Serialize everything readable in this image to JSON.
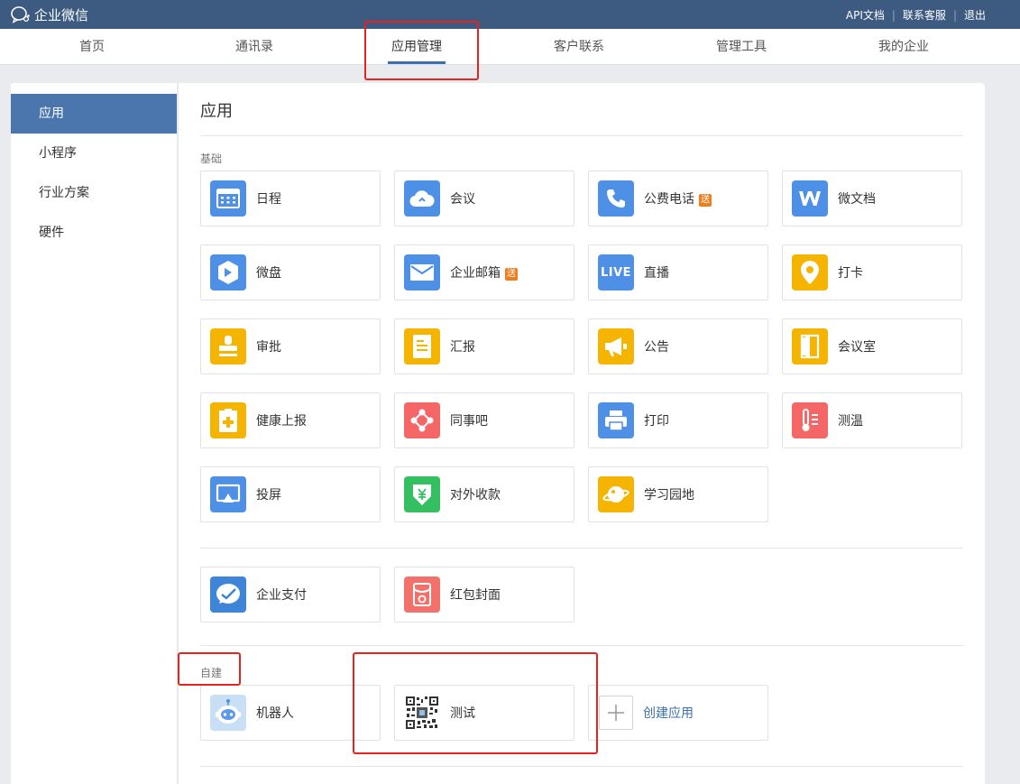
{
  "topbar": {
    "brand": "企业微信",
    "links": [
      "API文档",
      "联系客服",
      "退出"
    ]
  },
  "nav": {
    "tabs": [
      "首页",
      "通讯录",
      "应用管理",
      "客户联系",
      "管理工具",
      "我的企业"
    ],
    "active": "应用管理"
  },
  "sidebar": {
    "items": [
      "应用",
      "小程序",
      "行业方案",
      "硬件"
    ],
    "active": "应用"
  },
  "main": {
    "title": "应用",
    "basic_label": "基础",
    "basic_apps": [
      {
        "name": "日程",
        "icon": "calendar-icon",
        "color": "#4d90e5"
      },
      {
        "name": "会议",
        "icon": "cloud-meeting-icon",
        "color": "#4d90e5"
      },
      {
        "name": "公费电话",
        "icon": "phone-icon",
        "color": "#4d90e5",
        "badge": "送"
      },
      {
        "name": "微文档",
        "icon": "doc-w-icon",
        "color": "#4d90e5"
      },
      {
        "name": "微盘",
        "icon": "drive-icon",
        "color": "#4d90e5"
      },
      {
        "name": "企业邮箱",
        "icon": "mail-icon",
        "color": "#4d90e5",
        "badge": "送"
      },
      {
        "name": "直播",
        "icon": "live-icon",
        "color": "#4d90e5",
        "icon_text": "LIVE"
      },
      {
        "name": "打卡",
        "icon": "location-pin-icon",
        "color": "#f5b400"
      },
      {
        "name": "审批",
        "icon": "stamp-icon",
        "color": "#f5b400"
      },
      {
        "name": "汇报",
        "icon": "report-icon",
        "color": "#f5b400"
      },
      {
        "name": "公告",
        "icon": "megaphone-icon",
        "color": "#f5b400"
      },
      {
        "name": "会议室",
        "icon": "door-icon",
        "color": "#f5b400"
      },
      {
        "name": "健康上报",
        "icon": "health-clipboard-icon",
        "color": "#f5b400"
      },
      {
        "name": "同事吧",
        "icon": "colleague-network-icon",
        "color": "#f56767"
      },
      {
        "name": "打印",
        "icon": "printer-icon",
        "color": "#4d90e5"
      },
      {
        "name": "测温",
        "icon": "thermometer-icon",
        "color": "#f56767"
      },
      {
        "name": "投屏",
        "icon": "screen-cast-icon",
        "color": "#4d90e5"
      },
      {
        "name": "对外收款",
        "icon": "yuan-shield-icon",
        "color": "#34c060"
      },
      {
        "name": "学习园地",
        "icon": "planet-icon",
        "color": "#f5b400"
      }
    ],
    "pay_apps": [
      {
        "name": "企业支付",
        "icon": "enterprise-pay-icon",
        "color": "#3c85d8"
      },
      {
        "name": "红包封面",
        "icon": "red-envelope-icon",
        "color": "#f2716b"
      }
    ],
    "custom_label": "自建",
    "custom_apps": [
      {
        "name": "机器人",
        "icon": "robot-icon"
      },
      {
        "name": "测试",
        "icon": "qr-code-icon"
      },
      {
        "name": "创建应用",
        "icon": "plus-icon"
      }
    ]
  }
}
